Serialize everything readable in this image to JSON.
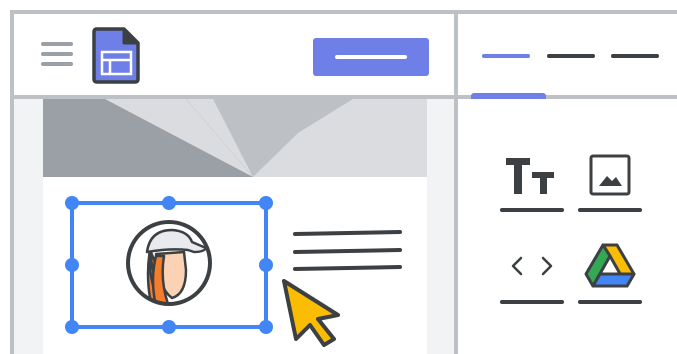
{
  "header": {
    "menu_icon": "hamburger-menu-icon",
    "logo_icon": "google-sites-icon",
    "primary_button_icon": "bar-placeholder-icon"
  },
  "panel": {
    "tabs": [
      {
        "icon": "bar-placeholder-icon",
        "active": true
      },
      {
        "icon": "bar-placeholder-icon",
        "active": false
      },
      {
        "icon": "bar-placeholder-icon",
        "active": false
      }
    ],
    "tools": [
      {
        "id": "text",
        "icon": "text-size-icon",
        "glyph": "Tт"
      },
      {
        "id": "image",
        "icon": "image-icon"
      },
      {
        "id": "embed",
        "icon": "code-icon",
        "glyph": "‹ ›"
      },
      {
        "id": "drive",
        "icon": "google-drive-icon"
      }
    ]
  },
  "canvas": {
    "banner_icon": "banner-image-placeholder",
    "selected_element_icon": "person-avatar-icon",
    "text_block_icon": "text-lines-icon",
    "cursor_icon": "mouse-pointer-icon"
  },
  "colors": {
    "accent": "#6f7fe8",
    "selection": "#4285f4",
    "frame": "#bdc1c6",
    "cursor": "#fbbc04",
    "hair": "#f57c2b",
    "dark": "#3c4043"
  }
}
